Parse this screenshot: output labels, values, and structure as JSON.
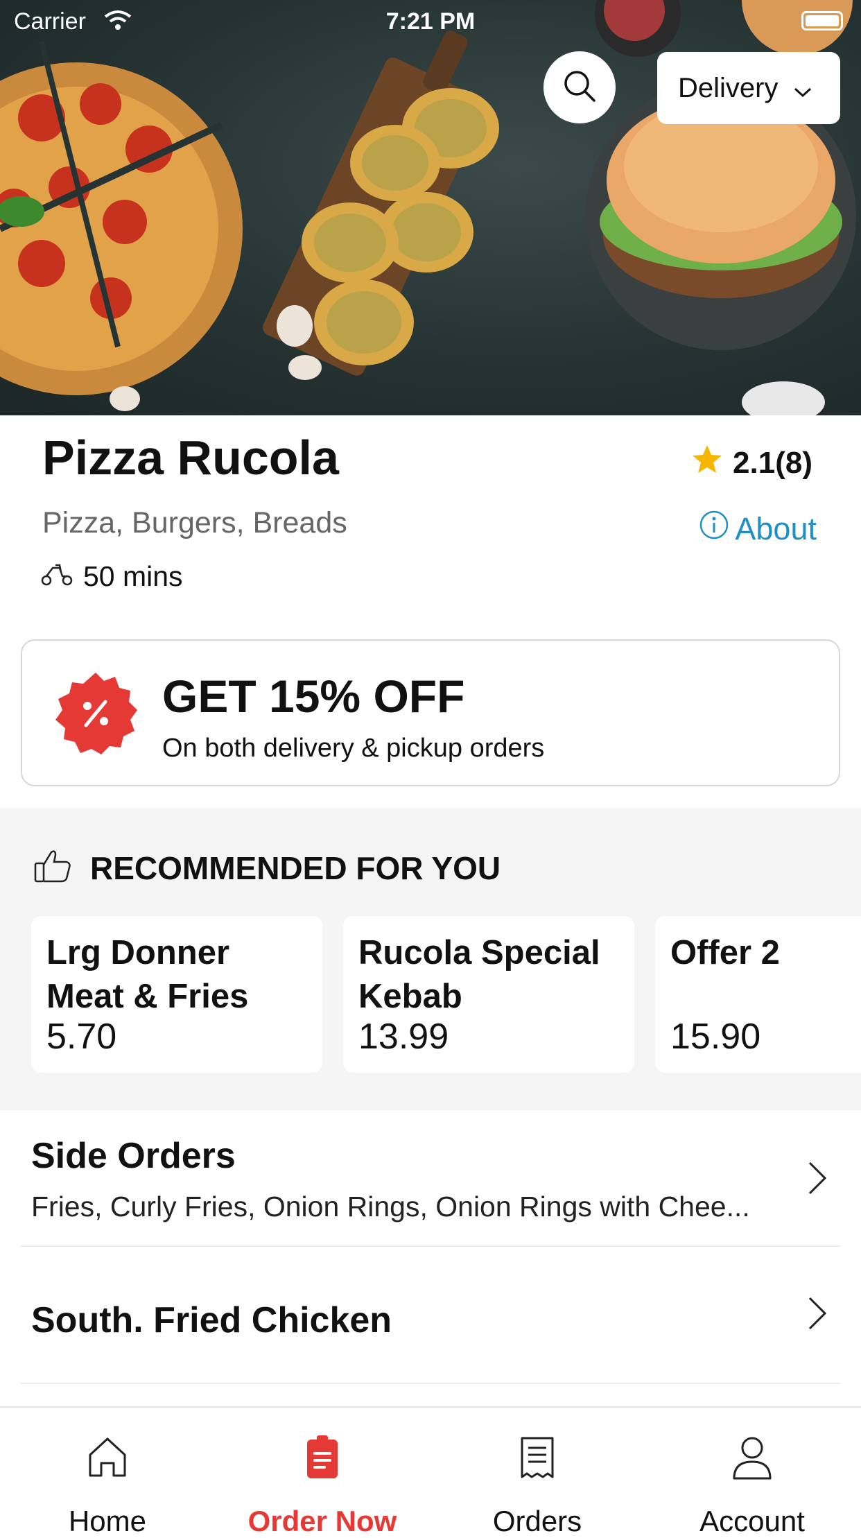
{
  "status_bar": {
    "carrier": "Carrier",
    "time": "7:21 PM"
  },
  "header": {
    "delivery_mode": "Delivery"
  },
  "restaurant": {
    "name": "Pizza Rucola",
    "rating": "2.1(8)",
    "cuisines": "Pizza, Burgers, Breads",
    "about_label": "About",
    "eta": "50 mins"
  },
  "offer": {
    "headline": "GET 15% OFF",
    "subtitle": "On both delivery & pickup orders"
  },
  "recommended": {
    "title": "RECOMMENDED FOR YOU",
    "items": [
      {
        "name": "Lrg Donner Meat & Fries",
        "price": "5.70"
      },
      {
        "name": "Rucola Special Kebab",
        "price": "13.99"
      },
      {
        "name": "Offer 2",
        "price": "15.90"
      }
    ]
  },
  "categories": [
    {
      "name": "Side Orders",
      "items": "Fries, Curly Fries, Onion Rings, Onion Rings with Chee..."
    },
    {
      "name": "South. Fried Chicken",
      "items": ""
    }
  ],
  "tabs": [
    {
      "label": "Home",
      "icon": "home-icon"
    },
    {
      "label": "Order Now",
      "icon": "order-icon",
      "active": true
    },
    {
      "label": "Orders",
      "icon": "receipt-icon"
    },
    {
      "label": "Account",
      "icon": "user-icon"
    }
  ],
  "colors": {
    "accent": "#e53935",
    "link": "#1f8fc6",
    "star": "#f7b500"
  }
}
